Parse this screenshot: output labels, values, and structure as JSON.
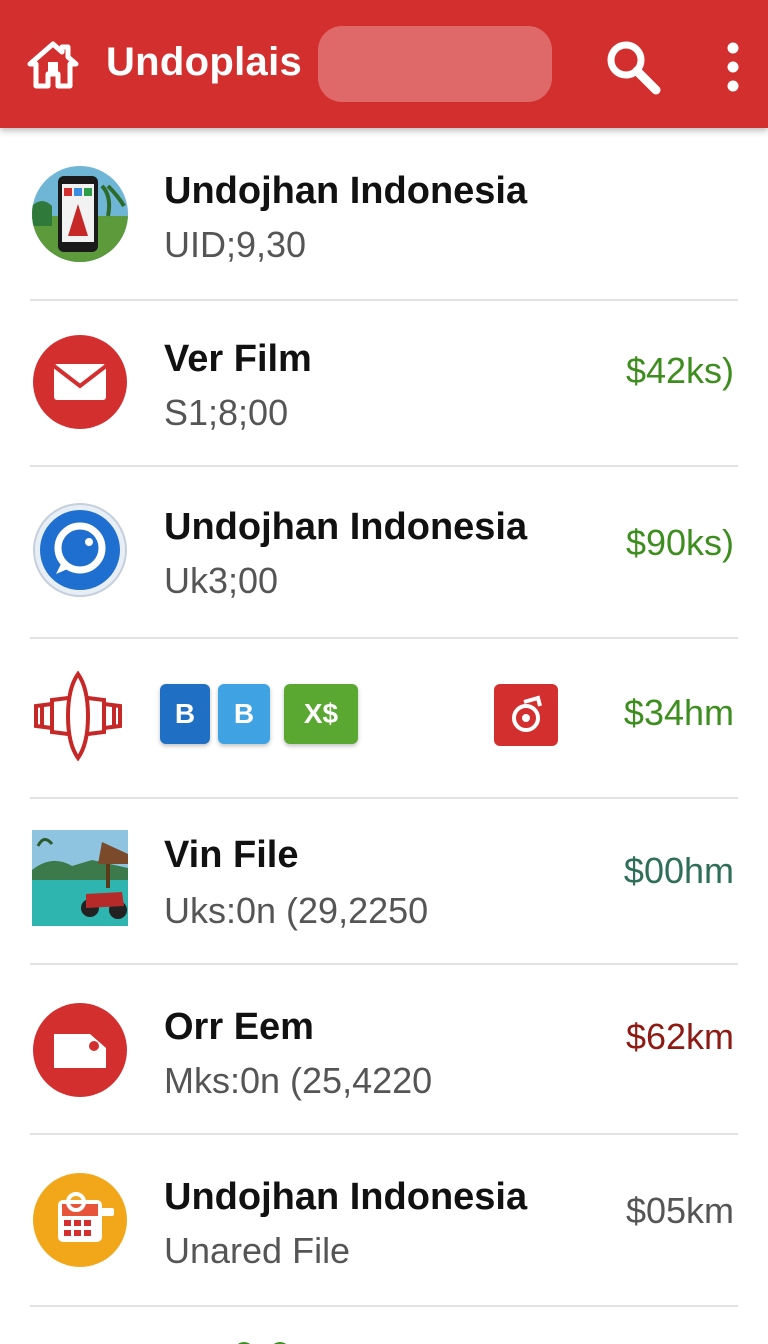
{
  "appbar": {
    "title": "Undoplais",
    "icons": [
      "home-icon",
      "search-icon",
      "more-vert-icon"
    ],
    "color": "#d32f2f"
  },
  "rows": [
    {
      "title": "Undojhan Indonesia",
      "subtitle": "UID;9,30",
      "amount": "",
      "icon": "phone-photo-icon"
    },
    {
      "title": "Ver Film",
      "subtitle": "S1;8;00",
      "amount": "$42ks)",
      "icon": "mail-icon"
    },
    {
      "title": "Undojhan Indonesia",
      "subtitle": "Uk3;00",
      "amount": "$90ks)",
      "icon": "chat-bubble-icon"
    },
    {
      "chips": [
        "B",
        "B",
        "X$"
      ],
      "amount": "$34hm",
      "icon": "ribbon-icon"
    },
    {
      "title": "Vin File",
      "subtitle": "Uks:0n (29,2250",
      "amount": "$00hm",
      "icon": "beach-photo-icon"
    },
    {
      "title": "Orr Eem",
      "subtitle": "Mks:0n (25,4220",
      "amount": "$62km",
      "icon": "tag-icon"
    },
    {
      "title": "Undojhan Indonesia",
      "subtitle": "Unared File",
      "amount": "$05km",
      "icon": "calendar-icon"
    }
  ],
  "colors": {
    "amount_green": "#3e8e1f",
    "amount_teal": "#2f6e58",
    "amount_darkred": "#8e1a14",
    "chip_blue": "#1f6fc5",
    "chip_lightblue": "#3fa2e3",
    "chip_green": "#5aa832"
  }
}
